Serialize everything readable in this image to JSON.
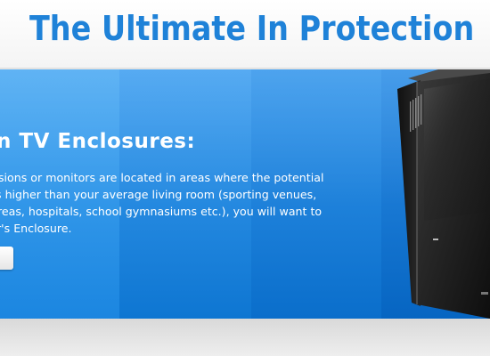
{
  "header": {
    "headline": "The Ultimate In Protection"
  },
  "banner": {
    "section_title": "n TV Enclosures:",
    "paragraph_lines": [
      "sions or monitors are located in areas where the potential",
      "s higher than your average living room (sporting venues,",
      "reas, hospitals, school gymnasiums etc.), you will want to",
      "r's Enclosure."
    ],
    "cta_label": "",
    "product_image_icon": "tv-enclosure-image"
  },
  "colors": {
    "headline": "#1f82d8",
    "banner_blue": "#1a7fd8",
    "text": "#ffffff"
  }
}
